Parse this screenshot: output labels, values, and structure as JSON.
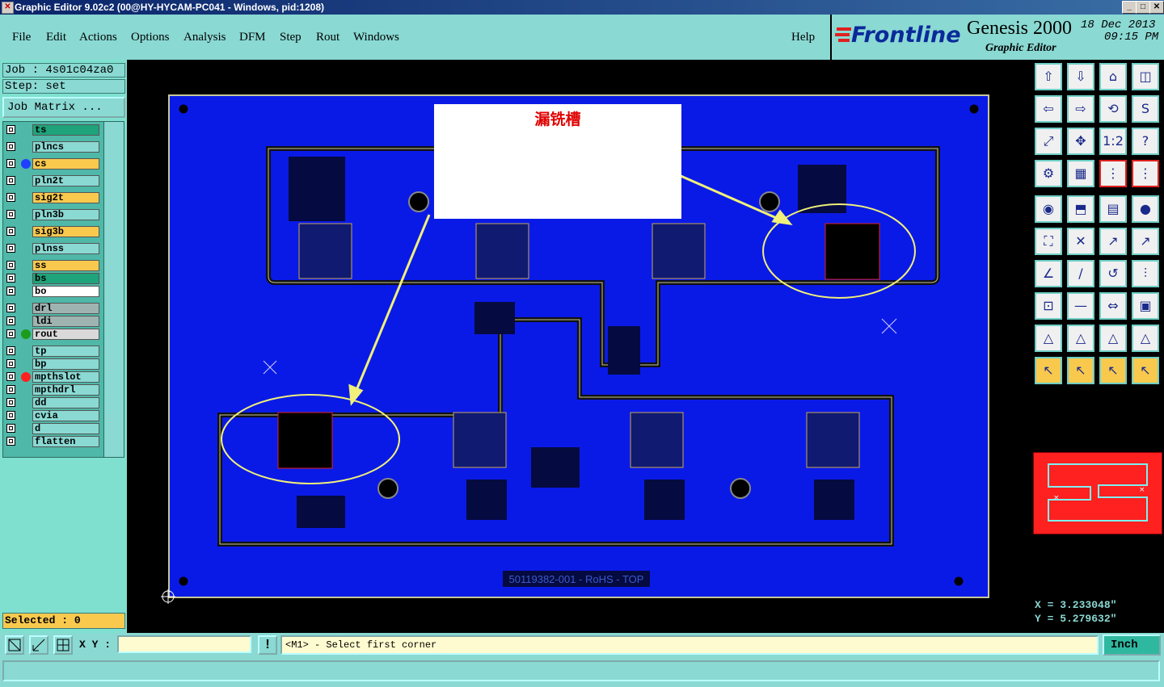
{
  "window": {
    "title": "Graphic Editor 9.02c2 (00@HY-HYCAM-PC041 - Windows, pid:1208)",
    "min": "_",
    "max": "□",
    "close": "✕"
  },
  "menu": {
    "items": [
      "File",
      "Edit",
      "Actions",
      "Options",
      "Analysis",
      "DFM",
      "Step",
      "Rout",
      "Windows"
    ],
    "help": "Help"
  },
  "brand": {
    "logo": "Frontline",
    "product": "Genesis 2000",
    "subtitle": "Graphic Editor",
    "date": "18 Dec 2013",
    "time": "09:15 PM"
  },
  "job": {
    "job_label": "Job : 4s01c04za0",
    "step_label": "Step: set",
    "matrix_button": "Job Matrix ..."
  },
  "layers": [
    {
      "name": "ts",
      "color": "#1fa37a",
      "dot": ""
    },
    {
      "name": "plncs",
      "color": "#8ad9d3",
      "dot": ""
    },
    {
      "name": "cs",
      "color": "#f9c94e",
      "dot": "#1f3fff"
    },
    {
      "name": "pln2t",
      "color": "#8ad9d3",
      "dot": ""
    },
    {
      "name": "sig2t",
      "color": "#f9c94e",
      "dot": ""
    },
    {
      "name": "pln3b",
      "color": "#8ad9d3",
      "dot": ""
    },
    {
      "name": "sig3b",
      "color": "#f9c94e",
      "dot": ""
    },
    {
      "name": "plnss",
      "color": "#8ad9d3",
      "dot": ""
    },
    {
      "name": "ss",
      "color": "#f9c94e",
      "dot": ""
    },
    {
      "name": "bs",
      "color": "#1fa37a",
      "dot": ""
    },
    {
      "name": "bo",
      "color": "#ffffff",
      "dot": ""
    },
    {
      "name": "drl",
      "color": "#9fb3b0",
      "dot": ""
    },
    {
      "name": "ldi",
      "color": "#9fb3b0",
      "dot": ""
    },
    {
      "name": "rout",
      "color": "#d9d9d9",
      "dot": "#1c9c1c"
    },
    {
      "name": "tp",
      "color": "#8ad9d3",
      "dot": ""
    },
    {
      "name": "bp",
      "color": "#8ad9d3",
      "dot": ""
    },
    {
      "name": "mpthslot",
      "color": "#8ad9d3",
      "dot": "#ff2020"
    },
    {
      "name": "mpthdrl",
      "color": "#8ad9d3",
      "dot": ""
    },
    {
      "name": "dd",
      "color": "#8ad9d3",
      "dot": ""
    },
    {
      "name": "cvia",
      "color": "#8ad9d3",
      "dot": ""
    },
    {
      "name": "d",
      "color": "#8ad9d3",
      "dot": ""
    },
    {
      "name": "flatten",
      "color": "#8ad9d3",
      "dot": ""
    }
  ],
  "selected": "Selected : 0",
  "canvas": {
    "annotation": "漏铣槽",
    "silkscreen": "50119382-001 - RoHS - TOP"
  },
  "coords": {
    "x": "X = 3.233048\"",
    "y": "Y = 5.279632\""
  },
  "command": {
    "xy_label": "X Y :",
    "xy_value": "",
    "exclaim": "!",
    "prompt": "<M1> - Select first corner",
    "units": "Inch"
  },
  "colors": {
    "board": "#0a1ae6",
    "panel": "#8ad9d3",
    "annotation": "#e00000",
    "ellipse": "#f0f07a"
  }
}
